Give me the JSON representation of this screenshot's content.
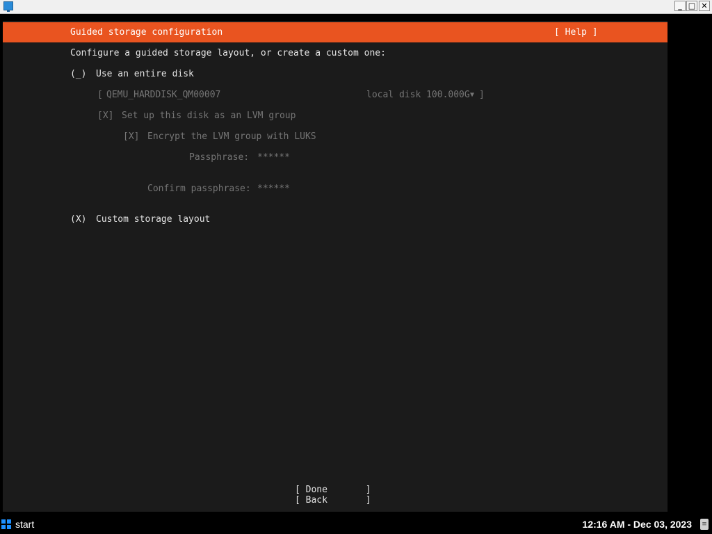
{
  "window": {
    "minimize_glyph": "_",
    "maximize_glyph": "□",
    "close_glyph": "✕"
  },
  "installer": {
    "header_title": "Guided storage configuration",
    "help_button": "[ Help ]",
    "intro": "Configure a guided storage layout, or create a custom one:",
    "entire_disk": {
      "radio": "(_)",
      "label": "Use an entire disk"
    },
    "disk_select": {
      "open_bracket": "[",
      "disk_name": "QEMU_HARDDISK_QM00007",
      "disk_info": "local disk 100.000G",
      "arrow": "▼",
      "close_bracket": "]"
    },
    "lvm": {
      "checkbox": "[X]",
      "label": "Set up this disk as an LVM group"
    },
    "luks": {
      "checkbox": "[X]",
      "label": "Encrypt the LVM group with LUKS"
    },
    "passphrase": {
      "label": "Passphrase:",
      "value": "******"
    },
    "confirm_passphrase": {
      "label": "Confirm passphrase:",
      "value": "******"
    },
    "custom_layout": {
      "radio": "(X)",
      "label": "Custom storage layout"
    },
    "buttons": {
      "done": "[ Done       ]",
      "back": "[ Back       ]"
    }
  },
  "taskbar": {
    "start_label": "start",
    "clock": "12:16 AM - Dec 03, 2023",
    "tray_glyph": "≡"
  },
  "colors": {
    "header_accent": "#e95420",
    "panel_background": "#1b1b1b",
    "text": "#e4e4e4",
    "disabled_text": "#757575"
  }
}
